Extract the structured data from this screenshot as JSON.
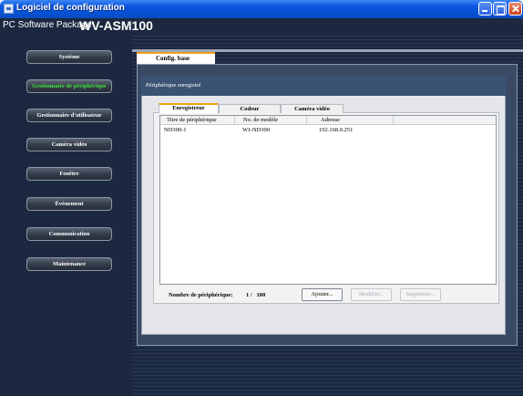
{
  "window": {
    "title": "Logiciel de configuration"
  },
  "header": {
    "package_label": "PC Software Package",
    "model": "WV-ASM100"
  },
  "sidebar": {
    "items": [
      {
        "label": "Système",
        "active": false
      },
      {
        "label": "Gestionnaire de périphérique",
        "active": true
      },
      {
        "label": "Gestionnaire d'utilisateur",
        "active": false
      },
      {
        "label": "Caméra vidéo",
        "active": false
      },
      {
        "label": "Fenêtre",
        "active": false
      },
      {
        "label": "Évènement",
        "active": false
      },
      {
        "label": "Communication",
        "active": false
      },
      {
        "label": "Maintenance",
        "active": false
      }
    ],
    "active_color": "#3fe23a"
  },
  "main": {
    "tab": "Config. base",
    "panel_title": "Périphérique enregistré",
    "subtabs": [
      "Enregistreur",
      "Codeur",
      "Caméra vidéo"
    ],
    "active_subtab": "Enregistreur",
    "table": {
      "columns": [
        "Titre de périphérique",
        "No. de modèle",
        "Adresse"
      ],
      "rows": [
        [
          "ND300-1",
          "WJ-ND300",
          "192.168.0.251"
        ]
      ]
    },
    "device_count_label": "Nombre de périphérique:",
    "device_count": "1 /   100",
    "buttons": {
      "add": "Ajouter...",
      "modify": "Modifier...",
      "delete": "Supprimer..."
    }
  },
  "colors": {
    "accent_orange": "#f2a01a",
    "titlebar_blue": "#0552d6",
    "background_navy": "#1b2840"
  }
}
